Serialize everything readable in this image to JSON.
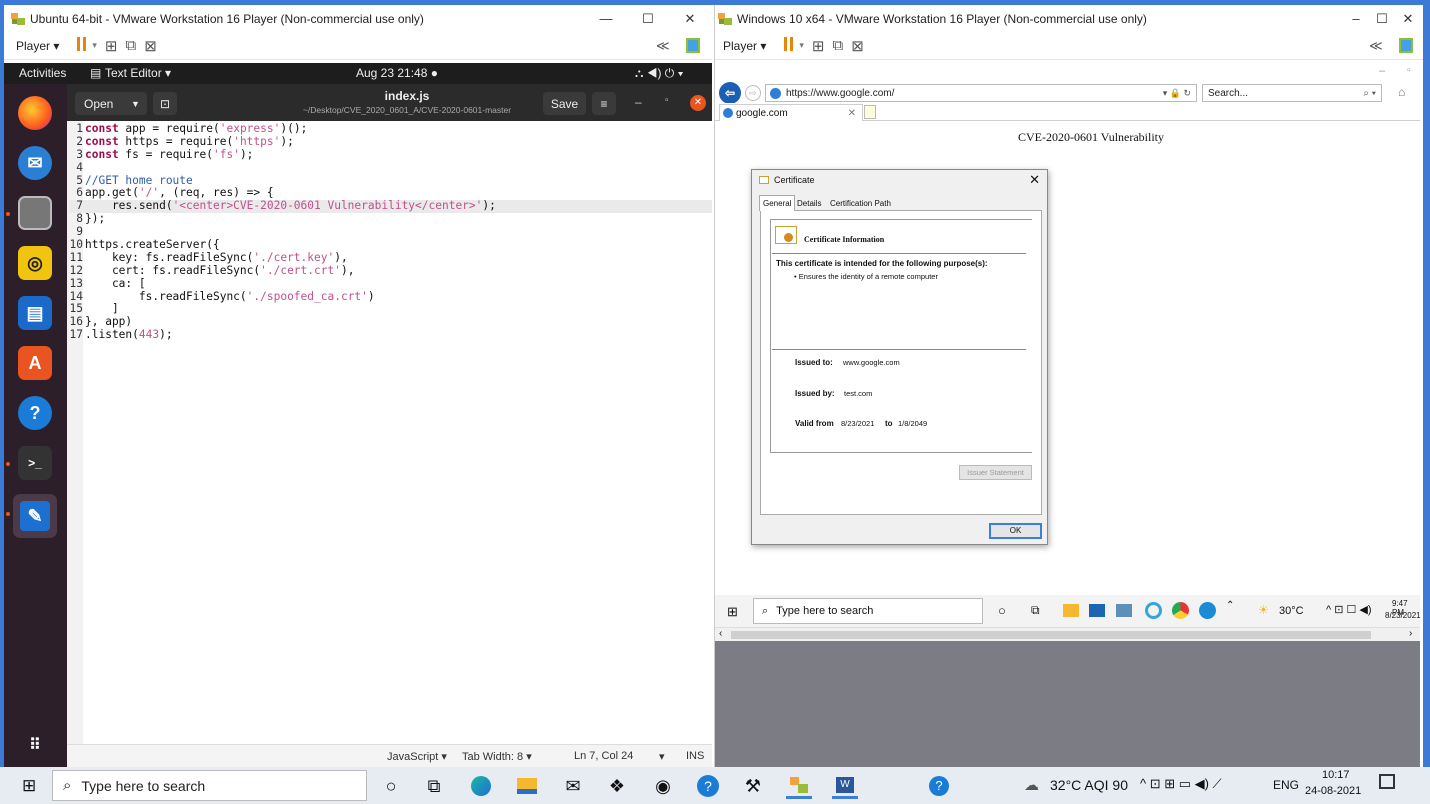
{
  "left_vm": {
    "title": "Ubuntu 64-bit - VMware Workstation 16 Player (Non-commercial use only)",
    "player_label": "Player ▾"
  },
  "right_vm": {
    "title": "Windows 10 x64 - VMware Workstation 16 Player (Non-commercial use only)",
    "player_label": "Player ▾"
  },
  "ubuntu": {
    "activities": "Activities",
    "app_menu": "Text Editor ▾",
    "clock": "Aug 23 21:48 ●",
    "tray": "⛬ ◀) ⏻ ▾"
  },
  "editor": {
    "open_label": "Open",
    "save_label": "Save",
    "filename": "index.js",
    "path": "~/Desktop/CVE_2020_0601_A/CVE-2020-0601-master",
    "status": {
      "language": "JavaScript ▾",
      "tab_width": "Tab Width: 8 ▾",
      "position": "Ln 7, Col 24",
      "mode": "INS"
    }
  },
  "code_lines": [
    [
      {
        "t": "1",
        "c": "ln"
      },
      {
        "t": "const",
        "c": "kw"
      },
      {
        "t": " app = require("
      },
      {
        "t": "'express'",
        "c": "str"
      },
      {
        "t": ")();"
      }
    ],
    [
      {
        "t": "2",
        "c": "ln"
      },
      {
        "t": "const",
        "c": "kw"
      },
      {
        "t": " https = require("
      },
      {
        "t": "'https'",
        "c": "str"
      },
      {
        "t": ");"
      }
    ],
    [
      {
        "t": "3",
        "c": "ln"
      },
      {
        "t": "const",
        "c": "kw"
      },
      {
        "t": " fs = require("
      },
      {
        "t": "'fs'",
        "c": "str"
      },
      {
        "t": ");"
      }
    ],
    [
      {
        "t": "4",
        "c": "ln"
      }
    ],
    [
      {
        "t": "5",
        "c": "ln"
      },
      {
        "t": "//GET home route",
        "c": "cmt"
      }
    ],
    [
      {
        "t": "6",
        "c": "ln"
      },
      {
        "t": "app.get("
      },
      {
        "t": "'/'",
        "c": "str"
      },
      {
        "t": ", (req, res) => {"
      }
    ],
    [
      {
        "t": "7",
        "c": "ln"
      },
      {
        "t": "    res.send("
      },
      {
        "t": "'<center>CVE-2020-0601 Vulnerability</center>'",
        "c": "str"
      },
      {
        "t": ");"
      }
    ],
    [
      {
        "t": "8",
        "c": "ln"
      },
      {
        "t": "});"
      }
    ],
    [
      {
        "t": "9",
        "c": "ln"
      }
    ],
    [
      {
        "t": "10",
        "c": "ln"
      },
      {
        "t": "https.createServer({"
      }
    ],
    [
      {
        "t": "11",
        "c": "ln"
      },
      {
        "t": "    key: fs.readFileSync("
      },
      {
        "t": "'./cert.key'",
        "c": "str"
      },
      {
        "t": "),"
      }
    ],
    [
      {
        "t": "12",
        "c": "ln"
      },
      {
        "t": "    cert: fs.readFileSync("
      },
      {
        "t": "'./cert.crt'",
        "c": "str"
      },
      {
        "t": "),"
      }
    ],
    [
      {
        "t": "13",
        "c": "ln"
      },
      {
        "t": "    ca: ["
      }
    ],
    [
      {
        "t": "14",
        "c": "ln"
      },
      {
        "t": "        fs.readFileSync("
      },
      {
        "t": "'./spoofed_ca.crt'",
        "c": "str"
      },
      {
        "t": ")"
      }
    ],
    [
      {
        "t": "15",
        "c": "ln"
      },
      {
        "t": "    ]"
      }
    ],
    [
      {
        "t": "16",
        "c": "ln"
      },
      {
        "t": "}, app)"
      }
    ],
    [
      {
        "t": "17",
        "c": "ln"
      },
      {
        "t": ".listen("
      },
      {
        "t": "443",
        "c": "num"
      },
      {
        "t": ");"
      }
    ]
  ],
  "browser": {
    "url": "https://www.google.com/",
    "search_placeholder": "Search...",
    "tab_label": "google.com",
    "page_heading": "CVE-2020-0601 Vulnerability"
  },
  "certificate": {
    "title": "Certificate",
    "tabs": [
      "General",
      "Details",
      "Certification Path"
    ],
    "info_heading": "Certificate Information",
    "purpose_heading": "This certificate is intended for the following purpose(s):",
    "purpose_item": "• Ensures the identity of a remote computer",
    "issued_to_label": "Issued to:",
    "issued_to": "www.google.com",
    "issued_by_label": "Issued by:",
    "issued_by": "test.com",
    "valid_from_label": "Valid from",
    "valid_from": "8/23/2021",
    "valid_to_label": "to",
    "valid_to": "1/8/2049",
    "issuer_statement": "Issuer Statement",
    "ok": "OK"
  },
  "guest_taskbar": {
    "search": "Type here to search",
    "weather": "30°C",
    "time": "9:47 PM",
    "date": "8/23/2021"
  },
  "host_taskbar": {
    "search": "Type here to search",
    "weather": "32°C AQI 90",
    "lang": "ENG",
    "time": "10:17",
    "date": "24-08-2021"
  }
}
